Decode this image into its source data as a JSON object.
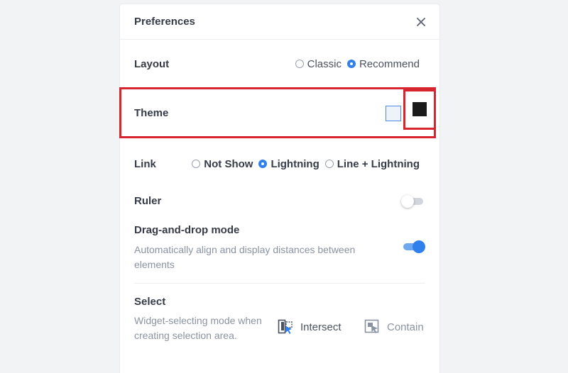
{
  "panel": {
    "title": "Preferences"
  },
  "layout": {
    "label": "Layout",
    "options": [
      {
        "label": "Classic",
        "selected": false
      },
      {
        "label": "Recommend",
        "selected": true
      }
    ]
  },
  "theme": {
    "label": "Theme",
    "options": [
      {
        "name": "light",
        "color": "#eef3f9"
      },
      {
        "name": "dark",
        "color": "#1b1b1b",
        "selected": true
      }
    ]
  },
  "link": {
    "label": "Link",
    "options": [
      {
        "label": "Not Show",
        "selected": false
      },
      {
        "label": "Lightning",
        "selected": true
      },
      {
        "label": "Line + Lightning",
        "selected": false
      }
    ]
  },
  "ruler": {
    "label": "Ruler",
    "enabled": false
  },
  "drag_drop": {
    "label": "Drag-and-drop mode",
    "description": "Automatically align and display distances between elements",
    "enabled": true
  },
  "select": {
    "label": "Select",
    "description": "Widget-selecting mode when creating selection area.",
    "options": [
      {
        "label": "Intersect",
        "icon": "intersect-select-icon",
        "selected": true
      },
      {
        "label": "Contain",
        "icon": "contain-select-icon",
        "selected": false
      }
    ]
  },
  "colors": {
    "accent": "#2f80ed",
    "highlight": "#d6252f"
  }
}
